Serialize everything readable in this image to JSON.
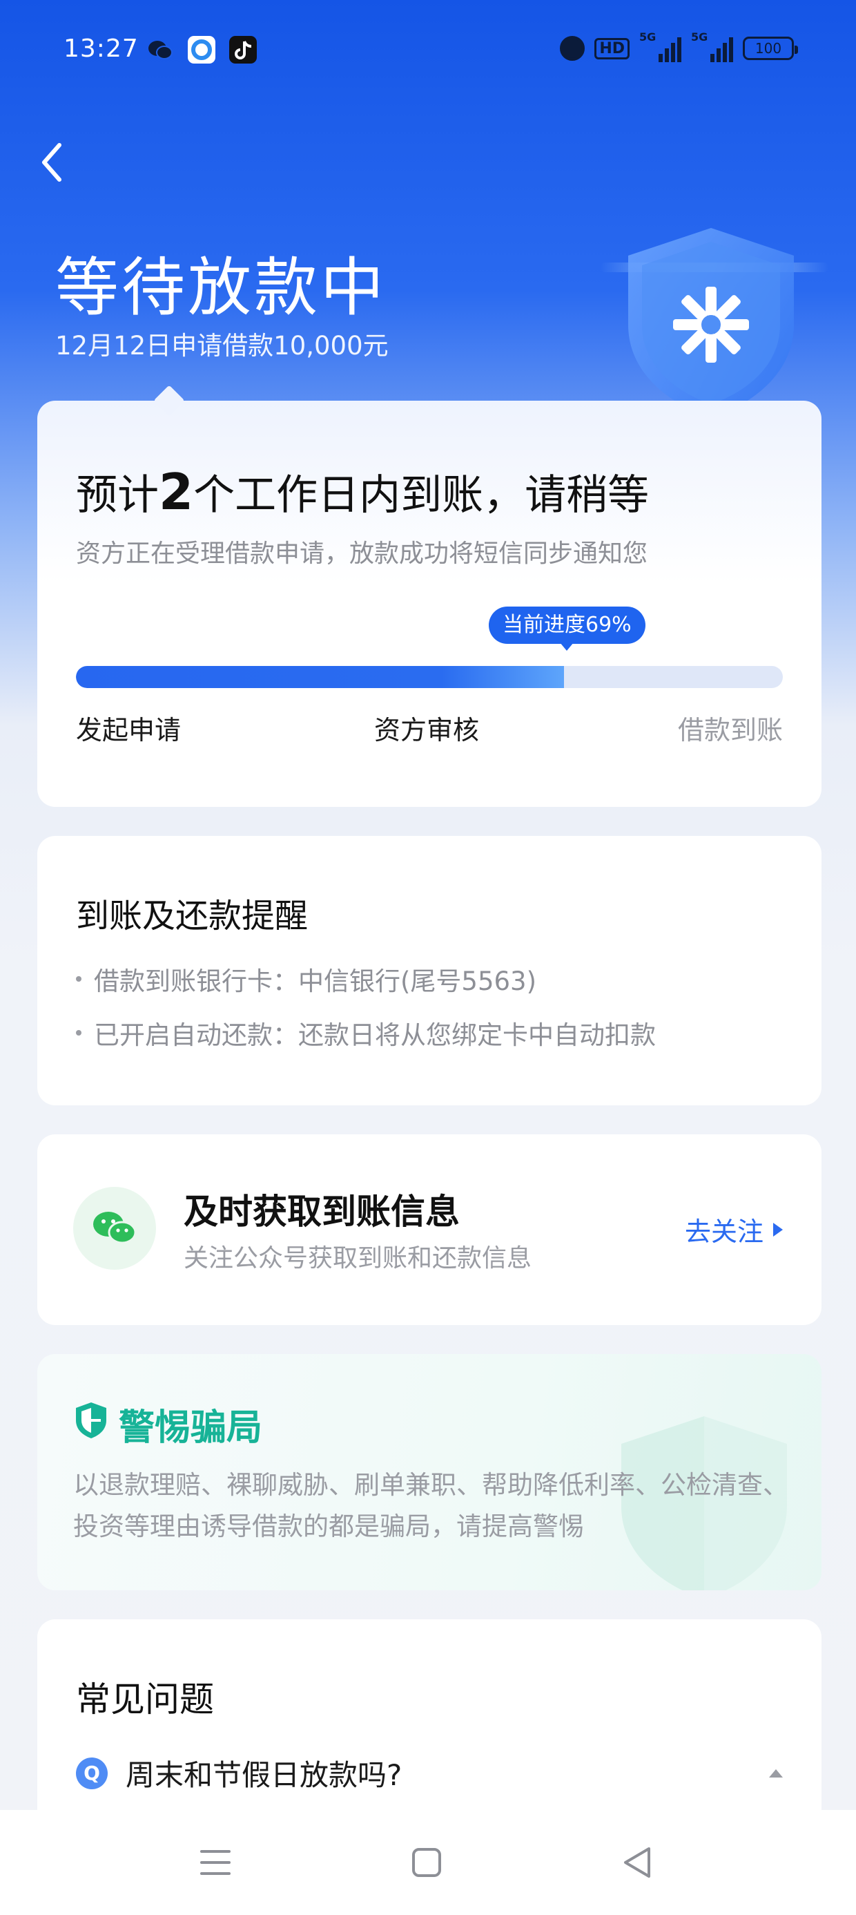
{
  "status_bar": {
    "time": "13:27",
    "signal_label_1": "5G",
    "signal_label_2": "5G",
    "hd_label": "HD",
    "battery": "100",
    "app_icons": [
      "wechat-icon",
      "browser-icon",
      "tiktok-icon"
    ]
  },
  "header": {
    "title": "等待放款中",
    "subtitle": "12月12日申请借款10,000元"
  },
  "progress_card": {
    "title_prefix": "预计",
    "title_number": "2",
    "title_suffix": "个工作日内到账，请稍等",
    "description": "资方正在受理借款申请，放款成功将短信同步通知您",
    "badge": "当前进度69%",
    "progress": 0.69,
    "steps": [
      "发起申请",
      "资方审核",
      "借款到账"
    ]
  },
  "reminder_card": {
    "title": "到账及还款提醒",
    "items": [
      "借款到账银行卡：中信银行(尾号5563)",
      "已开启自动还款：还款日将从您绑定卡中自动扣款"
    ]
  },
  "wechat_card": {
    "title": "及时获取到账信息",
    "description": "关注公众号获取到账和还款信息",
    "action": "去关注"
  },
  "warning_card": {
    "title": "警惕骗局",
    "text": "以退款理赔、裸聊威胁、刷单兼职、帮助降低利率、公检清查、投资等理由诱导借款的都是骗局，请提高警惕"
  },
  "faq_card": {
    "title": "常见问题",
    "question_icon": "Q",
    "questions": [
      "周末和节假日放款吗?"
    ]
  },
  "colors": {
    "primary": "#1f64ef",
    "accent_green": "#17b397",
    "wechat_green": "#2ebd5a"
  }
}
